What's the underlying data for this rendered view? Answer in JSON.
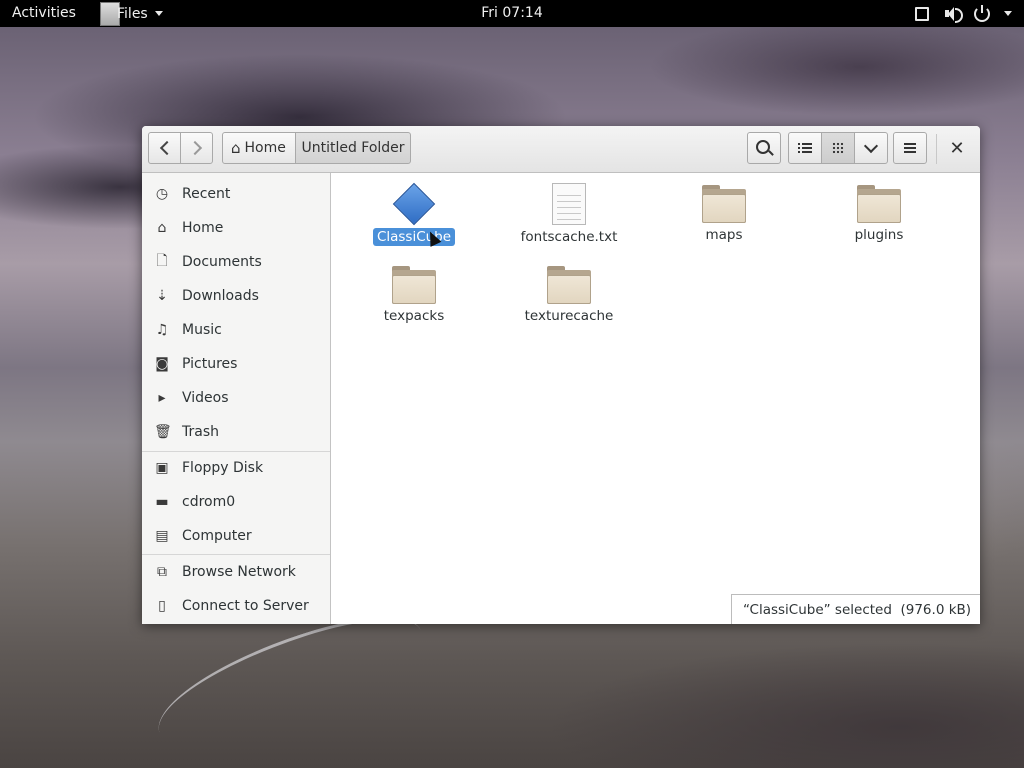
{
  "topbar": {
    "activities": "Activities",
    "app_menu": "Files",
    "clock": "Fri 07:14"
  },
  "icons": {
    "back": "chevron-left-icon",
    "forward": "chevron-right-icon",
    "home": "home-icon",
    "search": "search-icon",
    "list_view": "list-view-icon",
    "grid_view": "grid-view-icon",
    "view_options": "chevron-down-icon",
    "menu": "hamburger-menu-icon",
    "close": "close-icon"
  },
  "headerbar": {
    "breadcrumb_home": "Home",
    "breadcrumb_current": "Untitled Folder",
    "close_glyph": "✕"
  },
  "sidebar": {
    "places": [
      {
        "label": "Recent",
        "glyph": "◷",
        "icon": "recent-icon"
      },
      {
        "label": "Home",
        "glyph": "⌂",
        "icon": "home-icon"
      },
      {
        "label": "Documents",
        "glyph": "🗋",
        "icon": "documents-icon"
      },
      {
        "label": "Downloads",
        "glyph": "⇣",
        "icon": "downloads-icon"
      },
      {
        "label": "Music",
        "glyph": "♫",
        "icon": "music-icon"
      },
      {
        "label": "Pictures",
        "glyph": "◙",
        "icon": "pictures-icon"
      },
      {
        "label": "Videos",
        "glyph": "▸",
        "icon": "videos-icon"
      },
      {
        "label": "Trash",
        "glyph": "🗑",
        "icon": "trash-icon"
      }
    ],
    "devices": [
      {
        "label": "Floppy Disk",
        "glyph": "▣",
        "icon": "floppy-disk-icon"
      },
      {
        "label": "cdrom0",
        "glyph": "▬",
        "icon": "drive-icon"
      },
      {
        "label": "Computer",
        "glyph": "▤",
        "icon": "computer-icon"
      }
    ],
    "network": [
      {
        "label": "Browse Network",
        "glyph": "⧉",
        "icon": "network-icon"
      },
      {
        "label": "Connect to Server",
        "glyph": "▯",
        "icon": "server-icon"
      }
    ]
  },
  "files": [
    {
      "name": "ClassiCube",
      "type": "executable",
      "selected": true
    },
    {
      "name": "fontscache.txt",
      "type": "text"
    },
    {
      "name": "maps",
      "type": "folder"
    },
    {
      "name": "plugins",
      "type": "folder"
    },
    {
      "name": "texpacks",
      "type": "folder"
    },
    {
      "name": "texturecache",
      "type": "folder"
    }
  ],
  "status": "“ClassiCube” selected  (976.0 kB)",
  "colors": {
    "selection": "#4a90d9",
    "topbar": "#000000",
    "folder": "#e8dcc6"
  }
}
